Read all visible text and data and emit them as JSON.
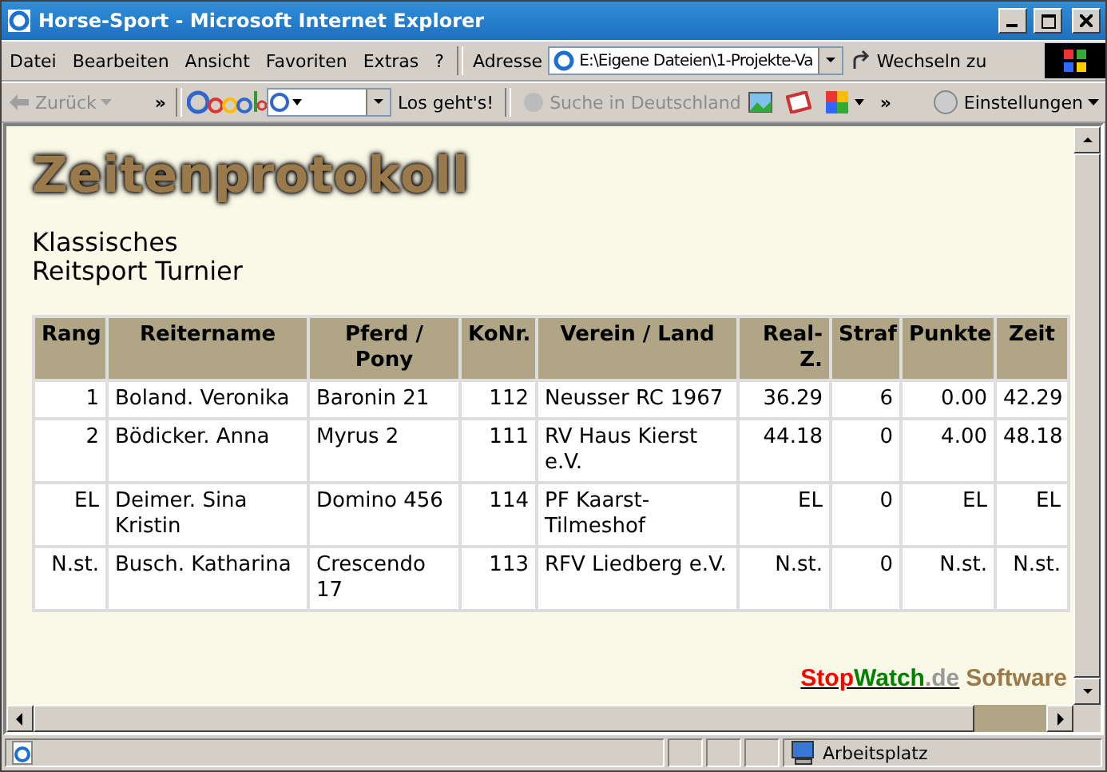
{
  "window": {
    "title": "Horse-Sport - Microsoft Internet Explorer"
  },
  "menu": [
    {
      "label": "Datei"
    },
    {
      "label": "Bearbeiten"
    },
    {
      "label": "Ansicht"
    },
    {
      "label": "Favoriten"
    },
    {
      "label": "Extras"
    },
    {
      "label": "?"
    }
  ],
  "address": {
    "label": "Adresse",
    "value": "E:\\Eigene Dateien\\1-Projekte-Va",
    "go": "Wechseln zu"
  },
  "toolbar": {
    "back": {
      "label": "Zurück",
      "disabled": true
    },
    "more": "»",
    "search_button": "Los geht's!",
    "search_germany": {
      "label": "Suche in Deutschland",
      "disabled": true
    },
    "more2": "»",
    "settings": "Einstellungen"
  },
  "page": {
    "heading": "Zeitenprotokoll",
    "subtitle": [
      "Klassisches",
      "Reitsport Turnier"
    ],
    "table": {
      "columns": [
        {
          "label": "Rang",
          "kind": "number"
        },
        {
          "label": "Reitername",
          "kind": "text"
        },
        {
          "label": "Pferd / Pony",
          "kind": "text"
        },
        {
          "label": "KoNr.",
          "kind": "number"
        },
        {
          "label": "Verein / Land",
          "kind": "text"
        },
        {
          "label": "Real-Z.",
          "kind": "number"
        },
        {
          "label": "Straf",
          "kind": "number"
        },
        {
          "label": "Punkte",
          "kind": "number"
        },
        {
          "label": "Zeit",
          "kind": "number"
        }
      ],
      "rows": [
        [
          "1",
          "Boland. Veronika",
          "Baronin 21",
          "112",
          "Neusser RC 1967",
          "36.29",
          "6",
          "0.00",
          "42.29"
        ],
        [
          "2",
          "Bödicker. Anna",
          "Myrus 2",
          "111",
          "RV Haus Kierst e.V.",
          "44.18",
          "0",
          "4.00",
          "48.18"
        ],
        [
          "EL",
          "Deimer. Sina Kristin",
          "Domino 456",
          "114",
          "PF Kaarst-Tilmeshof",
          "EL",
          "0",
          "EL",
          "EL"
        ],
        [
          "N.st.",
          "Busch. Katharina",
          "Crescendo 17",
          "113",
          "RFV Liedberg e.V.",
          "N.st.",
          "0",
          "N.st.",
          "N.st."
        ]
      ]
    },
    "footer": {
      "parts": [
        {
          "text": "Stop",
          "color": "#ff0000"
        },
        {
          "text": "Watch",
          "color": "#008000"
        },
        {
          "text": ".de",
          "color": "#999999"
        }
      ],
      "suffix": "Software"
    }
  },
  "status_bar": {
    "zone": "Arbeitsplatz"
  }
}
